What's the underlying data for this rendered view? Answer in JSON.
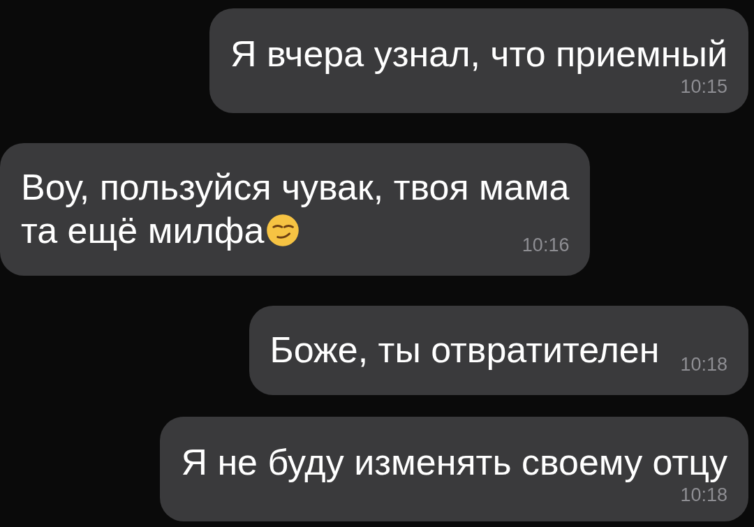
{
  "messages": [
    {
      "kind": "outgoing",
      "time_inline": false,
      "lines": [
        "Я вчера узнал, что приемный"
      ],
      "time": "10:15"
    },
    {
      "kind": "incoming",
      "time_inline": true,
      "lines": [
        "Воу, пользуйся чувак, твоя мама",
        "та ещё милфа"
      ],
      "has_emoji": true,
      "time": "10:16"
    },
    {
      "kind": "outgoing",
      "time_inline": true,
      "lines": [
        "Боже, ты отвратителен"
      ],
      "time": "10:18"
    },
    {
      "kind": "outgoing",
      "time_inline": false,
      "lines": [
        "Я не буду изменять своему отцу"
      ],
      "time": "10:18"
    }
  ]
}
